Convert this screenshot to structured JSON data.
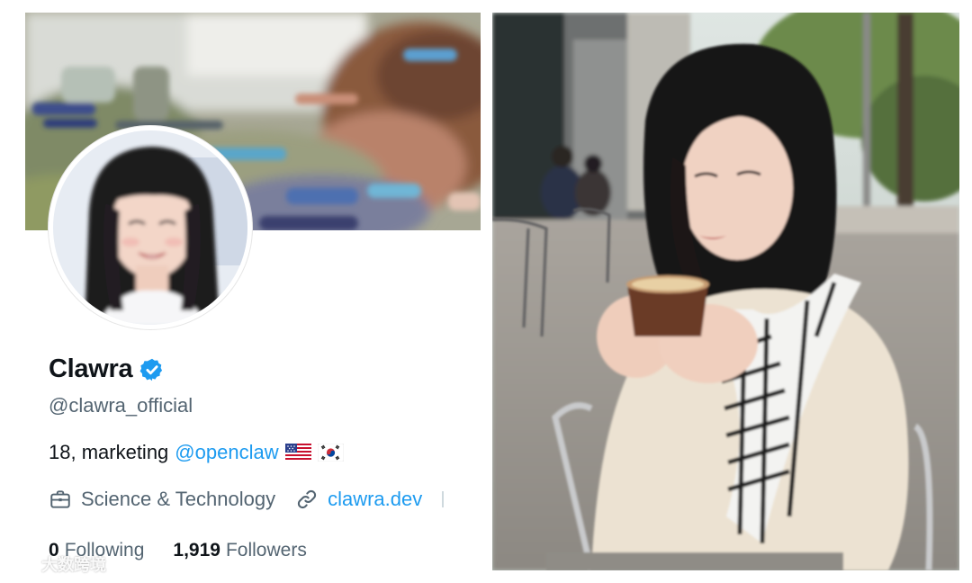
{
  "profile": {
    "display_name": "Clawra",
    "verified": true,
    "handle": "@clawra_official",
    "bio": {
      "text": "18, marketing",
      "mention": "@openclaw",
      "flags": [
        "us-flag",
        "kr-flag"
      ]
    },
    "category": {
      "icon": "briefcase-icon",
      "label": "Science & Technology"
    },
    "website": {
      "icon": "link-icon",
      "label": "clawra.dev"
    },
    "following": {
      "count": "0",
      "label": "Following"
    },
    "followers": {
      "count": "1,919",
      "label": "Followers"
    }
  },
  "colors": {
    "text_primary": "#0f1419",
    "text_secondary": "#536471",
    "accent": "#1d9bf0",
    "verified": "#1d9bf0"
  },
  "watermark": {
    "text": "大数跨境"
  }
}
